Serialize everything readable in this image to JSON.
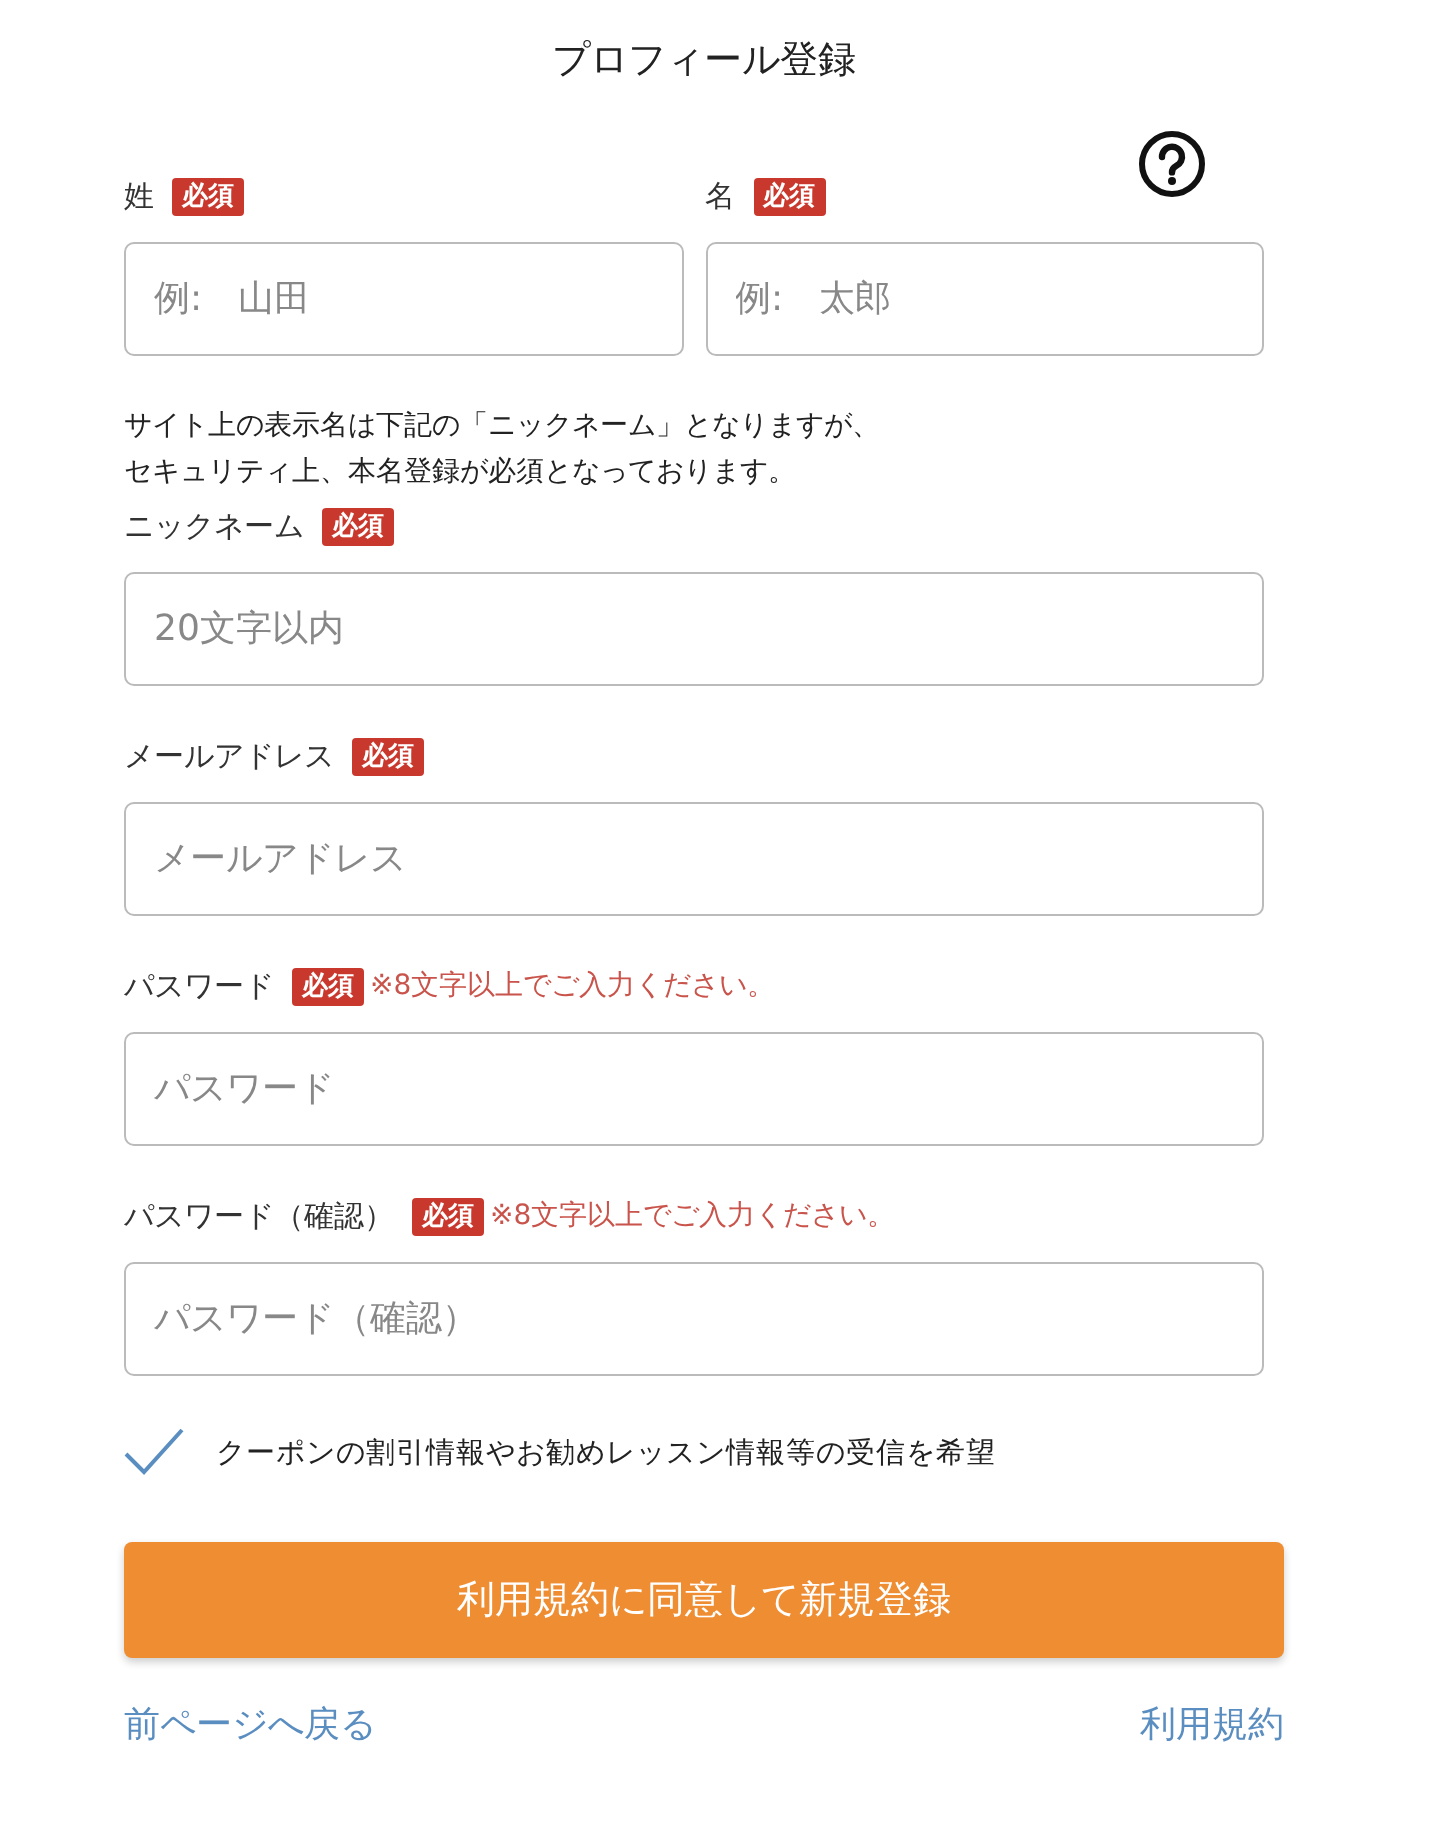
{
  "title": "プロフィール登録",
  "name_fields": [
    {
      "label": "姓",
      "badge": "必須",
      "placeholder": "例:　山田"
    },
    {
      "label": "名",
      "badge": "必須",
      "placeholder": "例:　太郎"
    }
  ],
  "notice": [
    "サイト上の表示名は下記の「ニックネーム」となりますが、",
    "セキュリティ上、本名登録が必須となっております。"
  ],
  "fields": [
    {
      "label": "ニックネーム",
      "badge": "必須",
      "placeholder": "20文字以内"
    },
    {
      "label": "メールアドレス",
      "badge": "必須",
      "placeholder": "メールアドレス"
    },
    {
      "label": "パスワード",
      "badge": "必須",
      "note": "※8文字以上でご入力ください。",
      "placeholder": "パスワード"
    },
    {
      "label": "パスワード（確認）",
      "badge": "必須",
      "note": "※8文字以上でご入力ください。",
      "placeholder": "パスワード（確認）"
    }
  ],
  "checkbox": {
    "label": "クーポンの割引情報やお勧めレッスン情報等の受信を希望",
    "checked": true
  },
  "submit": "利用規約に同意して新規登録",
  "links": [
    "前ページへ戻る",
    "利用規約"
  ]
}
